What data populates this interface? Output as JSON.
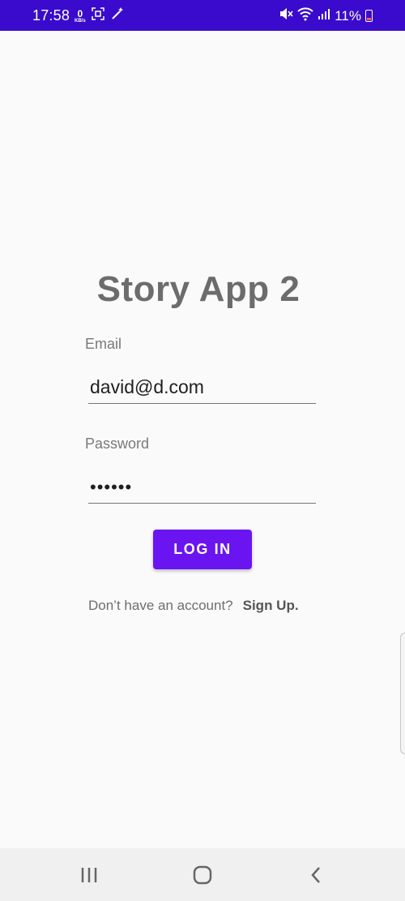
{
  "status_bar": {
    "time": "17:58",
    "data_speed_value": "0",
    "data_speed_unit": "KB/s",
    "battery_percent": "11%",
    "background_color": "#3a0bcc",
    "icons": [
      "data-speed-icon",
      "screen-capture-icon",
      "magic-wand-icon",
      "mute-icon",
      "wifi-icon",
      "signal-icon",
      "battery-icon"
    ]
  },
  "login": {
    "title": "Story App 2",
    "email_label": "Email",
    "email_value": "david@d.com",
    "password_label": "Password",
    "password_value": "••••••",
    "login_button_label": "LOG IN",
    "no_account_text": "Don’t have an account?",
    "signup_link_label": "Sign Up.",
    "accent_color": "#6a14f2"
  },
  "nav_bar": {
    "icons": [
      "recent-apps-icon",
      "home-icon",
      "back-icon"
    ]
  }
}
